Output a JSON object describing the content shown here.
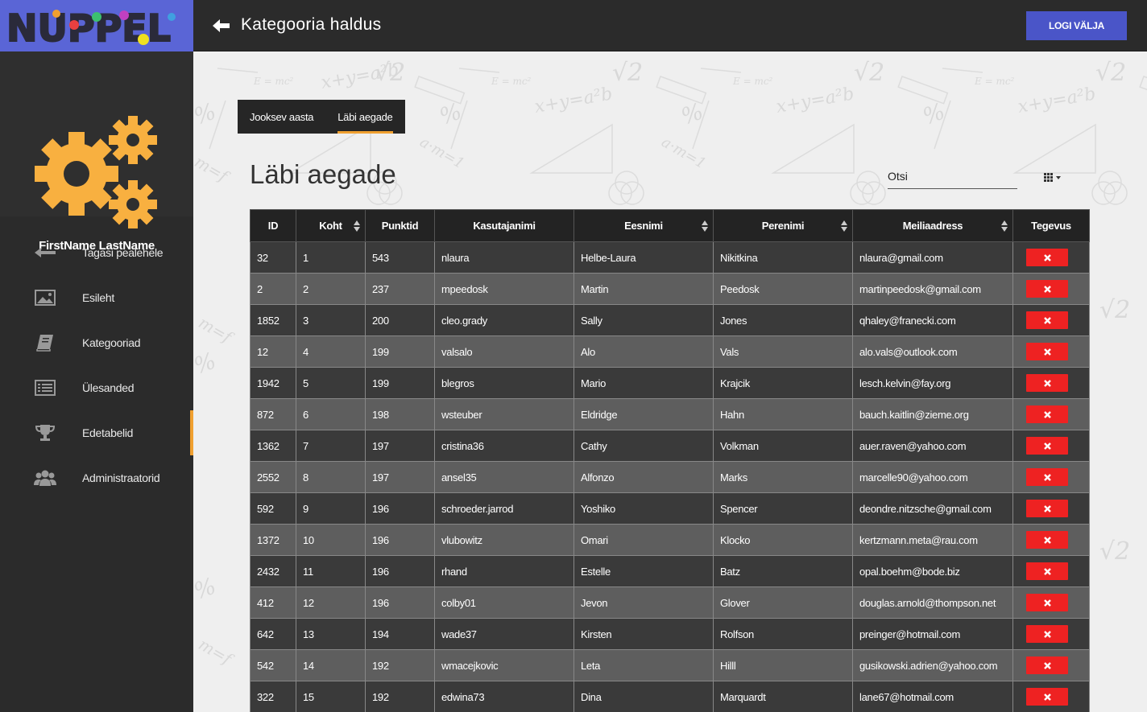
{
  "app": {
    "logo_text": "NUPPEL"
  },
  "profile": {
    "name": "FirstName LastName"
  },
  "nav": [
    {
      "label": "Tagasi pealehele",
      "icon": "arrow-left-icon"
    },
    {
      "label": "Esileht",
      "icon": "image-icon"
    },
    {
      "label": "Kategooriad",
      "icon": "book-icon"
    },
    {
      "label": "Ülesanded",
      "icon": "list-icon"
    },
    {
      "label": "Edetabelid",
      "icon": "trophy-icon",
      "active": true
    },
    {
      "label": "Administraatorid",
      "icon": "users-icon"
    }
  ],
  "header": {
    "title": "Kategooria haldus",
    "logout_label": "LOGI VÄLJA"
  },
  "tabs": [
    {
      "label": "Jooksev aasta"
    },
    {
      "label": "Läbi aegade",
      "active": true
    }
  ],
  "section_title": "Läbi aegade",
  "search": {
    "placeholder": "Otsi"
  },
  "table": {
    "columns": [
      "ID",
      "Koht",
      "Punktid",
      "Kasutajanimi",
      "Eesnimi",
      "Perenimi",
      "Meiliaadress",
      "Tegevus"
    ],
    "rows": [
      [
        "32",
        "1",
        "543",
        "nlaura",
        "Helbe-Laura",
        "Nikitkina",
        "nlaura@gmail.com"
      ],
      [
        "2",
        "2",
        "237",
        "mpeedosk",
        "Martin",
        "Peedosk",
        "martinpeedosk@gmail.com"
      ],
      [
        "1852",
        "3",
        "200",
        "cleo.grady",
        "Sally",
        "Jones",
        "qhaley@franecki.com"
      ],
      [
        "12",
        "4",
        "199",
        "valsalo",
        "Alo",
        "Vals",
        "alo.vals@outlook.com"
      ],
      [
        "1942",
        "5",
        "199",
        "blegros",
        "Mario",
        "Krajcik",
        "lesch.kelvin@fay.org"
      ],
      [
        "872",
        "6",
        "198",
        "wsteuber",
        "Eldridge",
        "Hahn",
        "bauch.kaitlin@zieme.org"
      ],
      [
        "1362",
        "7",
        "197",
        "cristina36",
        "Cathy",
        "Volkman",
        "auer.raven@yahoo.com"
      ],
      [
        "2552",
        "8",
        "197",
        "ansel35",
        "Alfonzo",
        "Marks",
        "marcelle90@yahoo.com"
      ],
      [
        "592",
        "9",
        "196",
        "schroeder.jarrod",
        "Yoshiko",
        "Spencer",
        "deondre.nitzsche@gmail.com"
      ],
      [
        "1372",
        "10",
        "196",
        "vlubowitz",
        "Omari",
        "Klocko",
        "kertzmann.meta@rau.com"
      ],
      [
        "2432",
        "11",
        "196",
        "rhand",
        "Estelle",
        "Batz",
        "opal.boehm@bode.biz"
      ],
      [
        "412",
        "12",
        "196",
        "colby01",
        "Jevon",
        "Glover",
        "douglas.arnold@thompson.net"
      ],
      [
        "642",
        "13",
        "194",
        "wade37",
        "Kirsten",
        "Rolfson",
        "preinger@hotmail.com"
      ],
      [
        "542",
        "14",
        "192",
        "wmacejkovic",
        "Leta",
        "Hilll",
        "gusikowski.adrien@yahoo.com"
      ],
      [
        "322",
        "15",
        "192",
        "edwina73",
        "Dina",
        "Marquardt",
        "lane67@hotmail.com"
      ]
    ]
  },
  "colors": {
    "accent": "#f0a030",
    "brand": "#5a65d6",
    "danger": "#ee2222"
  }
}
